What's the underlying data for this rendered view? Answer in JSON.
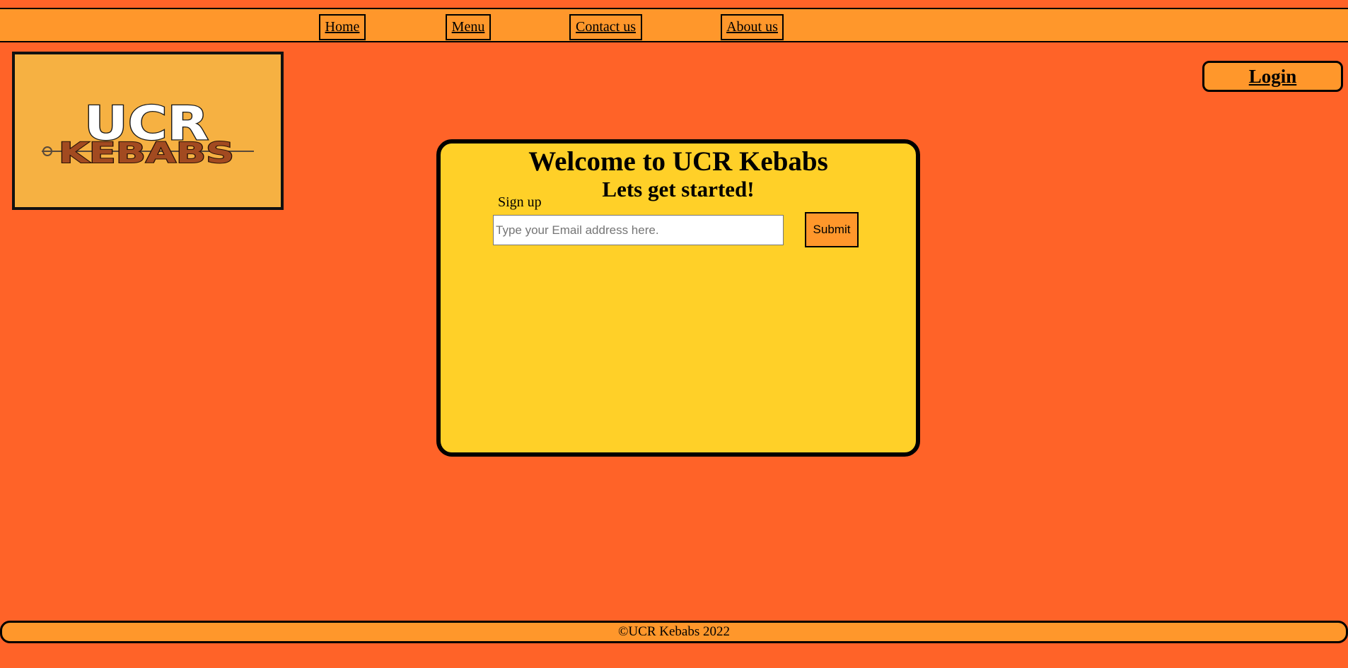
{
  "nav": {
    "items": [
      {
        "label": "Home"
      },
      {
        "label": "Menu"
      },
      {
        "label": "Contact us"
      },
      {
        "label": "About us"
      }
    ]
  },
  "logo": {
    "line1": "UCR",
    "line2": "KEBABS",
    "icon": "ucr-kebabs-logo"
  },
  "login": {
    "label": "Login"
  },
  "card": {
    "title": "Welcome to UCR Kebabs",
    "subtitle": "Lets get started!",
    "signup_label": "Sign up",
    "email_placeholder": "Type your Email address here.",
    "email_value": "",
    "submit_label": "Submit"
  },
  "footer": {
    "text": "©UCR Kebabs 2022"
  },
  "colors": {
    "page_background": "#ff6328",
    "nav_background": "#ff972b",
    "card_background": "#ffd028",
    "logo_background": "#f6b142",
    "button_background": "#ff972b"
  }
}
